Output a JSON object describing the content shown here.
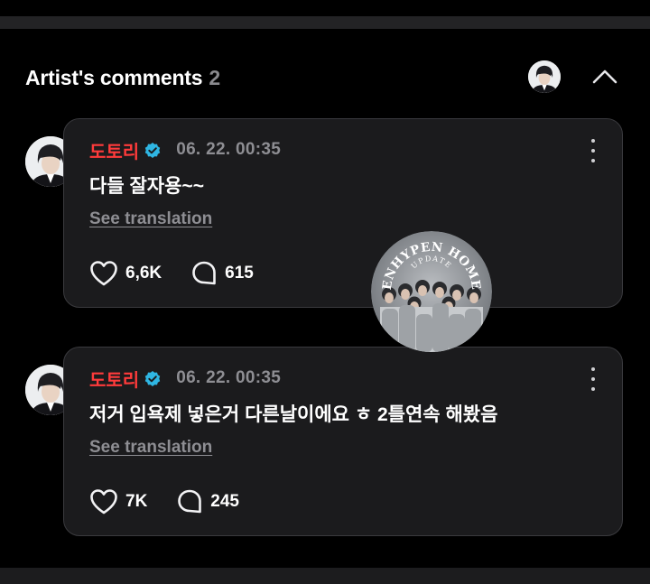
{
  "section": {
    "title": "Artist's comments",
    "count": "2"
  },
  "comments": [
    {
      "author": "도토리",
      "timestamp": "06. 22. 00:35",
      "text": "다들 잘자용~~",
      "translate_label": "See translation",
      "likes": "6,6K",
      "replies": "615"
    },
    {
      "author": "도토리",
      "timestamp": "06. 22. 00:35",
      "text": "저거 입욕제 넣은거 다른날이에요 ㅎ 2틀연속 해봤음",
      "translate_label": "See translation",
      "likes": "7K",
      "replies": "245"
    }
  ],
  "watermark": {
    "line1": "ENHYPEN HOME",
    "line2": "UPDATE"
  },
  "colors": {
    "author": "#ff3b3b",
    "verified": "#2fb6e3",
    "card_bg": "#1b1b1d",
    "muted": "#8e8e93"
  },
  "icons": {
    "verified": "verified-badge-icon",
    "like": "heart-icon",
    "reply": "speech-bubble-icon",
    "more": "more-vertical-icon",
    "collapse": "chevron-up-icon"
  }
}
